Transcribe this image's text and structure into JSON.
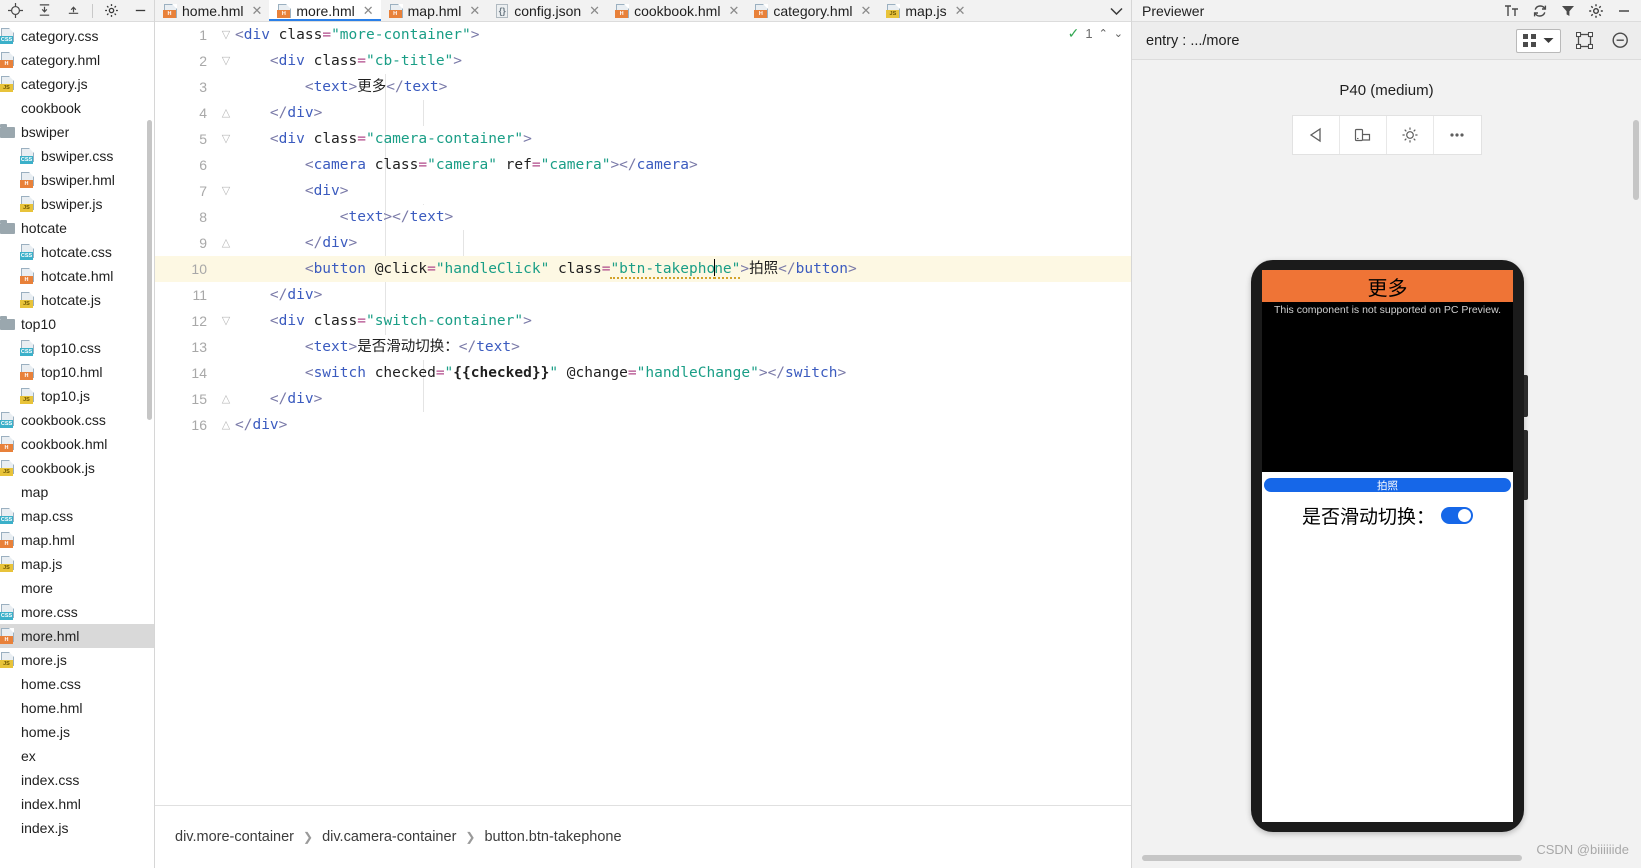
{
  "sidebar": {
    "toolbar": [
      "target-icon",
      "collapse-all-icon",
      "expand-icon",
      "settings-icon",
      "minimize-icon"
    ],
    "tree": [
      {
        "label": "category.css",
        "type": "css",
        "indent": 0
      },
      {
        "label": "category.hml",
        "type": "html",
        "indent": 0
      },
      {
        "label": "category.js",
        "type": "js",
        "indent": 0
      },
      {
        "label": "cookbook",
        "type": "none",
        "indent": 0
      },
      {
        "label": "bswiper",
        "type": "folder",
        "indent": 0
      },
      {
        "label": "bswiper.css",
        "type": "css",
        "indent": 1
      },
      {
        "label": "bswiper.hml",
        "type": "html",
        "indent": 1
      },
      {
        "label": "bswiper.js",
        "type": "js",
        "indent": 1
      },
      {
        "label": "hotcate",
        "type": "folder",
        "indent": 0
      },
      {
        "label": "hotcate.css",
        "type": "css",
        "indent": 1
      },
      {
        "label": "hotcate.hml",
        "type": "html",
        "indent": 1
      },
      {
        "label": "hotcate.js",
        "type": "js",
        "indent": 1
      },
      {
        "label": "top10",
        "type": "folder",
        "indent": 0
      },
      {
        "label": "top10.css",
        "type": "css",
        "indent": 1
      },
      {
        "label": "top10.hml",
        "type": "html",
        "indent": 1
      },
      {
        "label": "top10.js",
        "type": "js",
        "indent": 1
      },
      {
        "label": "cookbook.css",
        "type": "css",
        "indent": 0
      },
      {
        "label": "cookbook.hml",
        "type": "html",
        "indent": 0
      },
      {
        "label": "cookbook.js",
        "type": "js",
        "indent": 0
      },
      {
        "label": "map",
        "type": "none",
        "indent": 0
      },
      {
        "label": "map.css",
        "type": "css",
        "indent": 0
      },
      {
        "label": "map.hml",
        "type": "html",
        "indent": 0
      },
      {
        "label": "map.js",
        "type": "js",
        "indent": 0
      },
      {
        "label": "more",
        "type": "none",
        "indent": 0
      },
      {
        "label": "more.css",
        "type": "css",
        "indent": 0
      },
      {
        "label": "more.hml",
        "type": "html",
        "indent": 0,
        "selected": true
      },
      {
        "label": "more.js",
        "type": "js",
        "indent": 0
      },
      {
        "label": "home.css",
        "type": "none",
        "indent": 0
      },
      {
        "label": "home.hml",
        "type": "none",
        "indent": 0
      },
      {
        "label": "home.js",
        "type": "none",
        "indent": 0
      },
      {
        "label": "ex",
        "type": "none",
        "indent": 0
      },
      {
        "label": "index.css",
        "type": "none",
        "indent": 0
      },
      {
        "label": "index.hml",
        "type": "none",
        "indent": 0
      },
      {
        "label": "index.js",
        "type": "none",
        "indent": 0
      }
    ]
  },
  "tabs": [
    {
      "label": "home.hml",
      "type": "html",
      "active": false
    },
    {
      "label": "more.hml",
      "type": "html",
      "active": true
    },
    {
      "label": "map.hml",
      "type": "html",
      "active": false
    },
    {
      "label": "config.json",
      "type": "json",
      "active": false
    },
    {
      "label": "cookbook.hml",
      "type": "html",
      "active": false
    },
    {
      "label": "category.hml",
      "type": "html",
      "active": false
    },
    {
      "label": "map.js",
      "type": "js",
      "active": false
    }
  ],
  "editor": {
    "status": {
      "check": "✓",
      "count": "1",
      "up": "⌃",
      "down": "⌄"
    },
    "lines": [
      {
        "num": "1",
        "fold": "▽",
        "indent": 0,
        "tokens": [
          {
            "t": "<",
            "c": "t-punct"
          },
          {
            "t": "div",
            "c": "t-tag"
          },
          {
            "t": " class",
            "c": "t-attr"
          },
          {
            "t": "=",
            "c": "t-eq"
          },
          {
            "t": "\"more-container\"",
            "c": "t-str"
          },
          {
            "t": ">",
            "c": "t-punct"
          }
        ]
      },
      {
        "num": "2",
        "fold": "▽",
        "indent": 1,
        "tokens": [
          {
            "t": "<",
            "c": "t-punct"
          },
          {
            "t": "div",
            "c": "t-tag"
          },
          {
            "t": " class",
            "c": "t-attr"
          },
          {
            "t": "=",
            "c": "t-eq"
          },
          {
            "t": "\"cb-title\"",
            "c": "t-str"
          },
          {
            "t": ">",
            "c": "t-punct"
          }
        ]
      },
      {
        "num": "3",
        "fold": "",
        "indent": 2,
        "tokens": [
          {
            "t": "<",
            "c": "t-punct"
          },
          {
            "t": "text",
            "c": "t-tag"
          },
          {
            "t": ">",
            "c": "t-punct"
          },
          {
            "t": "更多",
            "c": "t-txt"
          },
          {
            "t": "</",
            "c": "t-punct"
          },
          {
            "t": "text",
            "c": "t-tag"
          },
          {
            "t": ">",
            "c": "t-punct"
          }
        ]
      },
      {
        "num": "4",
        "fold": "△",
        "indent": 1,
        "tokens": [
          {
            "t": "</",
            "c": "t-punct"
          },
          {
            "t": "div",
            "c": "t-tag"
          },
          {
            "t": ">",
            "c": "t-punct"
          }
        ]
      },
      {
        "num": "5",
        "fold": "▽",
        "indent": 1,
        "tokens": [
          {
            "t": "<",
            "c": "t-punct"
          },
          {
            "t": "div",
            "c": "t-tag"
          },
          {
            "t": " class",
            "c": "t-attr"
          },
          {
            "t": "=",
            "c": "t-eq"
          },
          {
            "t": "\"camera-container\"",
            "c": "t-str"
          },
          {
            "t": ">",
            "c": "t-punct"
          }
        ]
      },
      {
        "num": "6",
        "fold": "",
        "indent": 2,
        "tokens": [
          {
            "t": "<",
            "c": "t-punct"
          },
          {
            "t": "camera",
            "c": "t-tag"
          },
          {
            "t": " class",
            "c": "t-attr"
          },
          {
            "t": "=",
            "c": "t-eq"
          },
          {
            "t": "\"camera\"",
            "c": "t-str"
          },
          {
            "t": " ref",
            "c": "t-attr"
          },
          {
            "t": "=",
            "c": "t-eq"
          },
          {
            "t": "\"camera\"",
            "c": "t-str"
          },
          {
            "t": ">",
            "c": "t-punct"
          },
          {
            "t": "</",
            "c": "t-punct"
          },
          {
            "t": "camera",
            "c": "t-tag"
          },
          {
            "t": ">",
            "c": "t-punct"
          }
        ]
      },
      {
        "num": "7",
        "fold": "▽",
        "indent": 2,
        "tokens": [
          {
            "t": "<",
            "c": "t-punct"
          },
          {
            "t": "div",
            "c": "t-tag"
          },
          {
            "t": ">",
            "c": "t-punct"
          }
        ]
      },
      {
        "num": "8",
        "fold": "",
        "indent": 3,
        "tokens": [
          {
            "t": "<",
            "c": "t-punct"
          },
          {
            "t": "text",
            "c": "t-tag"
          },
          {
            "t": ">",
            "c": "t-punct"
          },
          {
            "t": "</",
            "c": "t-punct"
          },
          {
            "t": "text",
            "c": "t-tag"
          },
          {
            "t": ">",
            "c": "t-punct"
          }
        ]
      },
      {
        "num": "9",
        "fold": "△",
        "indent": 2,
        "tokens": [
          {
            "t": "</",
            "c": "t-punct"
          },
          {
            "t": "div",
            "c": "t-tag"
          },
          {
            "t": ">",
            "c": "t-punct"
          }
        ]
      },
      {
        "num": "10",
        "fold": "",
        "indent": 2,
        "highlight": true,
        "tokens": [
          {
            "t": "<",
            "c": "t-punct"
          },
          {
            "t": "button",
            "c": "t-tag"
          },
          {
            "t": " @click",
            "c": "t-attr"
          },
          {
            "t": "=",
            "c": "t-eq"
          },
          {
            "t": "\"handleClick\"",
            "c": "t-str"
          },
          {
            "t": " class",
            "c": "t-attr"
          },
          {
            "t": "=",
            "c": "t-eq"
          },
          {
            "t": "\"btn-takephone\"",
            "c": "t-str"
          },
          {
            "t": ">",
            "c": "t-punct"
          },
          {
            "t": "拍照",
            "c": "t-txt"
          },
          {
            "t": "</",
            "c": "t-punct"
          },
          {
            "t": "button",
            "c": "t-tag"
          },
          {
            "t": ">",
            "c": "t-punct"
          }
        ]
      },
      {
        "num": "11",
        "fold": "",
        "indent": 1,
        "tokens": [
          {
            "t": "</",
            "c": "t-punct"
          },
          {
            "t": "div",
            "c": "t-tag"
          },
          {
            "t": ">",
            "c": "t-punct"
          }
        ]
      },
      {
        "num": "12",
        "fold": "▽",
        "indent": 1,
        "tokens": [
          {
            "t": "<",
            "c": "t-punct"
          },
          {
            "t": "div",
            "c": "t-tag"
          },
          {
            "t": " class",
            "c": "t-attr"
          },
          {
            "t": "=",
            "c": "t-eq"
          },
          {
            "t": "\"switch-container\"",
            "c": "t-str"
          },
          {
            "t": ">",
            "c": "t-punct"
          }
        ]
      },
      {
        "num": "13",
        "fold": "",
        "indent": 2,
        "tokens": [
          {
            "t": "<",
            "c": "t-punct"
          },
          {
            "t": "text",
            "c": "t-tag"
          },
          {
            "t": ">",
            "c": "t-punct"
          },
          {
            "t": "是否滑动切换：",
            "c": "t-txt"
          },
          {
            "t": "</",
            "c": "t-punct"
          },
          {
            "t": "text",
            "c": "t-tag"
          },
          {
            "t": ">",
            "c": "t-punct"
          }
        ]
      },
      {
        "num": "14",
        "fold": "",
        "indent": 2,
        "tokens": [
          {
            "t": "<",
            "c": "t-punct"
          },
          {
            "t": "switch",
            "c": "t-tag"
          },
          {
            "t": " checked",
            "c": "t-attr"
          },
          {
            "t": "=",
            "c": "t-eq"
          },
          {
            "t": "\"",
            "c": "t-str"
          },
          {
            "t": "{{checked}}",
            "c": "t-mus"
          },
          {
            "t": "\"",
            "c": "t-str"
          },
          {
            "t": " @change",
            "c": "t-attr"
          },
          {
            "t": "=",
            "c": "t-eq"
          },
          {
            "t": "\"handleChange\"",
            "c": "t-str"
          },
          {
            "t": ">",
            "c": "t-punct"
          },
          {
            "t": "</",
            "c": "t-punct"
          },
          {
            "t": "switch",
            "c": "t-tag"
          },
          {
            "t": ">",
            "c": "t-punct"
          }
        ]
      },
      {
        "num": "15",
        "fold": "△",
        "indent": 1,
        "tokens": [
          {
            "t": "</",
            "c": "t-punct"
          },
          {
            "t": "div",
            "c": "t-tag"
          },
          {
            "t": ">",
            "c": "t-punct"
          }
        ]
      },
      {
        "num": "16",
        "fold": "△",
        "indent": 0,
        "tokens": [
          {
            "t": "</",
            "c": "t-punct"
          },
          {
            "t": "div",
            "c": "t-tag"
          },
          {
            "t": ">",
            "c": "t-punct"
          }
        ]
      }
    ]
  },
  "breadcrumb": [
    {
      "label": "div.more-container"
    },
    {
      "label": "div.camera-container"
    },
    {
      "label": "button.btn-takephone"
    }
  ],
  "previewer": {
    "title": "Previewer",
    "entry_label": "entry : .../more",
    "device_name": "P40 (medium)",
    "device_tools": [
      "rotate-left-icon",
      "orientation-icon",
      "brightness-icon",
      "more-icon"
    ],
    "header_tools": [
      "text-size-icon",
      "refresh-icon",
      "filter-icon",
      "settings-icon",
      "minimize-icon"
    ]
  },
  "phone_app": {
    "title": "更多",
    "camera_message": "This component is not supported on PC Preview.",
    "take_photo_label": "拍照",
    "switch_label": "是否滑动切换：",
    "switch_on": true
  },
  "watermark": "CSDN @biiiiiide",
  "colors": {
    "accent_blue": "#1667e8",
    "app_orange": "#ef7436",
    "tab_active_underline": "#2a7fe8",
    "highlight_line": "#fdf8e3"
  }
}
